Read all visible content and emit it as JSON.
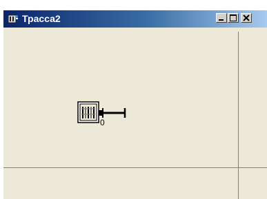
{
  "window": {
    "title": "Трасса2"
  },
  "titlebar": {
    "icon": "app-icon",
    "buttons": [
      "minimize-icon",
      "maximize-icon",
      "close-icon"
    ]
  },
  "canvas": {
    "component": {
      "icon": "trace-block-icon",
      "port_label": "0"
    }
  }
}
